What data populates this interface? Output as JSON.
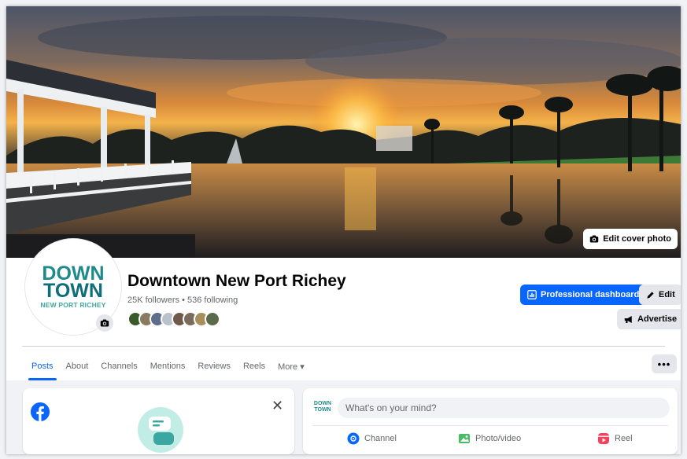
{
  "cover": {
    "edit_cover_label": "Edit cover photo"
  },
  "profile": {
    "logo_line1": "DOWN",
    "logo_line2": "TOWN",
    "logo_sub": "NEW PORT RICHEY",
    "name": "Downtown New Port Richey",
    "stats": "25K followers • 536 following",
    "friend_colors": [
      "#3a5a2a",
      "#8a7a60",
      "#5c6e8a",
      "#b9c2cc",
      "#6e5a48",
      "#7a6b5c",
      "#a88e5c",
      "#5a6a4a"
    ]
  },
  "actions": {
    "professional_dashboard": "Professional dashboard",
    "edit": "Edit",
    "advertise": "Advertise"
  },
  "tabs": [
    "Posts",
    "About",
    "Channels",
    "Mentions",
    "Reviews",
    "Reels",
    "More ▾"
  ],
  "more_menu": "•••",
  "left_card": {
    "close": "✕"
  },
  "composer": {
    "mini_logo": "DOWN TOWN",
    "placeholder": "What's on your mind?",
    "channel": "Channel",
    "photo_video": "Photo/video",
    "reel": "Reel"
  },
  "colors": {
    "brand_blue": "#0866ff",
    "logo_teal": "#1f8a8c",
    "photo_green": "#45bd62",
    "reel_red": "#f3425f"
  }
}
